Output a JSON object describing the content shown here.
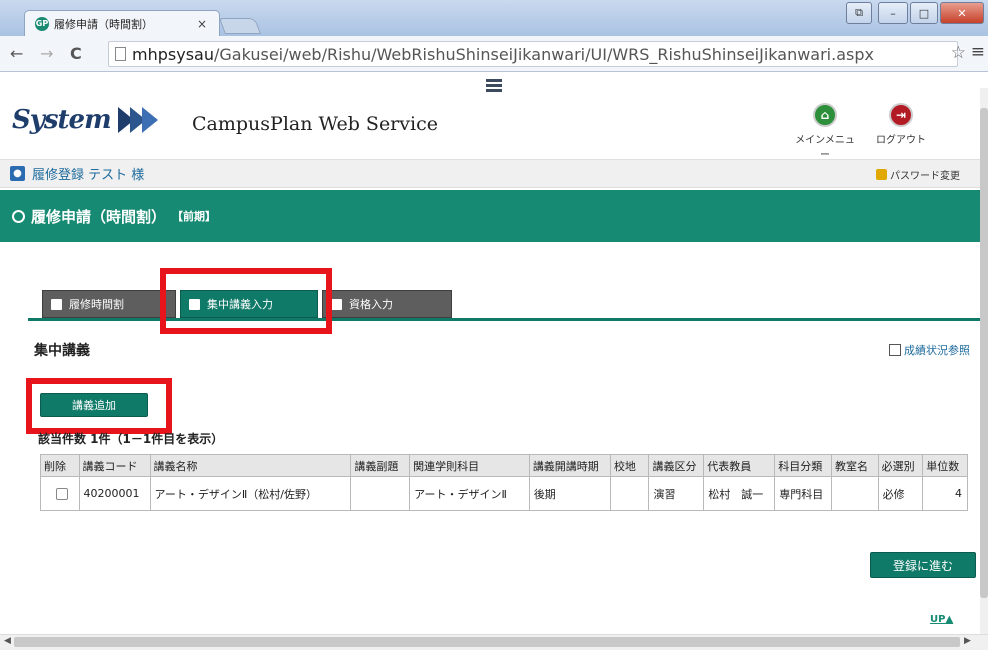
{
  "browser": {
    "tab_title": "履修申請（時間割）",
    "tab_close": "×",
    "url_host": "mhpsysau",
    "url_path": "/Gakusei/web/Rishu/WebRishuShinseiJikanwari/UI/WRS_RishuShinseiJikanwari.aspx",
    "back": "←",
    "forward": "→",
    "reload": "C",
    "star": "☆",
    "menu": "≡",
    "window_controls": [
      "⧉",
      "–",
      "□",
      "✕"
    ]
  },
  "header": {
    "logo_text": "System",
    "service_name": "CampusPlan Web Service",
    "main_menu_label": "メインメニュー",
    "logout_label": "ログアウト"
  },
  "subbar": {
    "text": "履修登録 テスト 様",
    "password_change": "パスワード変更"
  },
  "page": {
    "title": "履修申請（時間割）",
    "term": "【前期】"
  },
  "tabs": [
    {
      "label": "履修時間割",
      "active": false
    },
    {
      "label": "集中講義入力",
      "active": true
    },
    {
      "label": "資格入力",
      "active": false
    }
  ],
  "section": {
    "title": "集中講義",
    "grade_link": "成績状況参照",
    "add_button": "講義追加",
    "count_label": "該当件数 1件（1－1件目を表示）"
  },
  "table": {
    "headers": [
      "削除",
      "講義コード",
      "講義名称",
      "講義副題",
      "関連学則科目",
      "講義開講時期",
      "校地",
      "講義区分",
      "代表教員",
      "科目分類",
      "教室名",
      "必選別",
      "単位数"
    ],
    "rows": [
      {
        "code": "40200001",
        "name": "アート・デザインⅡ（松村/佐野）",
        "subtitle": "",
        "related": "アート・デザインⅡ",
        "period": "後期",
        "campus": "",
        "kind": "演習",
        "teacher": "松村　誠一",
        "category": "専門科目",
        "room": "",
        "required": "必修",
        "credits": "4"
      }
    ]
  },
  "footer": {
    "next_button": "登録に進む",
    "up_link": "UP"
  },
  "colors": {
    "accent": "#168a72",
    "highlight": "#e8141b"
  }
}
